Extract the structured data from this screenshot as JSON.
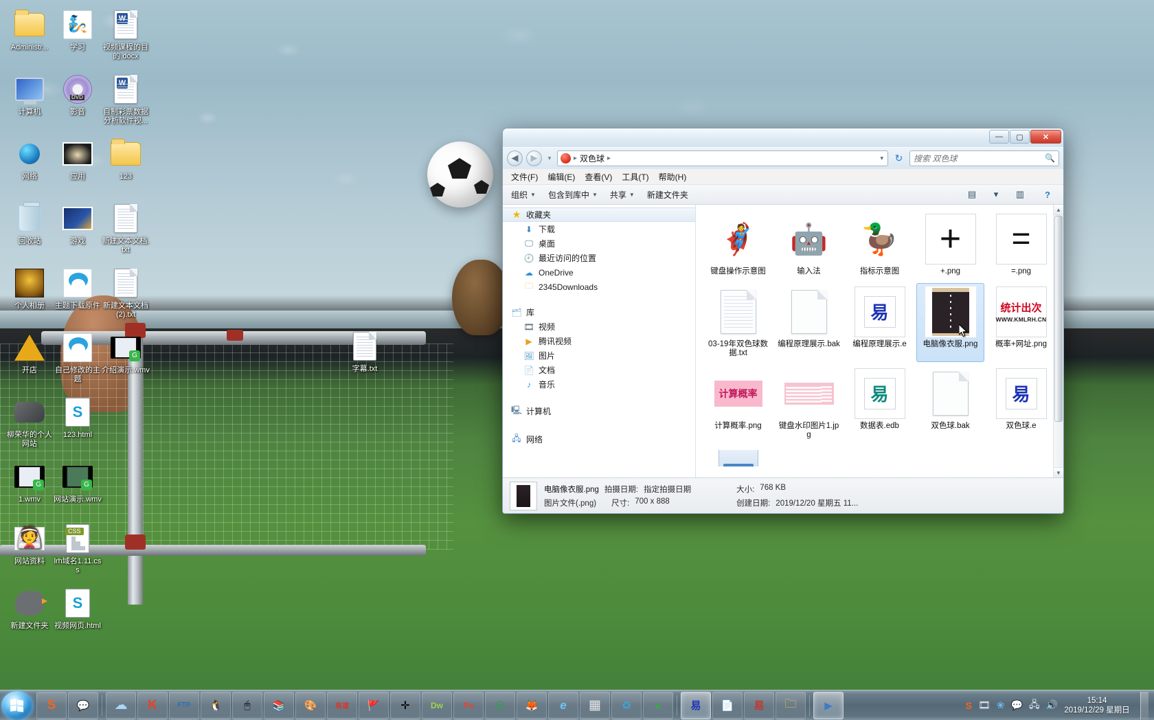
{
  "desktop": {
    "icons": [
      {
        "label": "Administr...",
        "icon": "user-folder-icon",
        "art": "folder-user"
      },
      {
        "label": "学习",
        "icon": "smurf-picture-icon",
        "art": "smurf"
      },
      {
        "label": "视频课程的目的.docx",
        "icon": "word-document-icon",
        "art": "word"
      },
      {
        "label": "计算机",
        "icon": "computer-icon",
        "art": "monitor"
      },
      {
        "label": "影音",
        "icon": "dvd-disc-icon",
        "art": "dvd"
      },
      {
        "label": "自制彩票数据分析软件视...",
        "icon": "word-document-icon",
        "art": "word"
      },
      {
        "label": "网络",
        "icon": "network-icon",
        "art": "globe"
      },
      {
        "label": "应用",
        "icon": "picture-icon",
        "art": "pic-lamp"
      },
      {
        "label": "123",
        "icon": "folder-icon",
        "art": "folder-docs"
      },
      {
        "label": "回收站",
        "icon": "recycle-bin-icon",
        "art": "trash"
      },
      {
        "label": "游戏",
        "icon": "picture-icon",
        "art": "pic-game"
      },
      {
        "label": "新建文本文档.txt",
        "icon": "text-document-icon",
        "art": "txt"
      },
      {
        "label": "个人相册",
        "icon": "picture-icon",
        "art": "mask"
      },
      {
        "label": "主题下载原件",
        "icon": "doraemon-picture-icon",
        "art": "dora"
      },
      {
        "label": "新建文本文档(2).txt",
        "icon": "text-document-icon",
        "art": "txt"
      },
      {
        "label": "开店",
        "icon": "pyramid-icon",
        "art": "pyramid"
      },
      {
        "label": "自己修改的主题",
        "icon": "doraemon-picture-icon",
        "art": "dora"
      },
      {
        "label": "介绍演示.wmv",
        "icon": "video-file-icon",
        "art": "film"
      },
      {
        "label": "柳荣华的个人网站",
        "icon": "whistle-icon",
        "art": "whistle"
      },
      {
        "label": "123.html",
        "icon": "sogou-html-icon",
        "art": "s-doc"
      },
      {
        "label": "1.wmv",
        "icon": "video-file-icon",
        "art": "film"
      },
      {
        "label": "网站演示.wmv",
        "icon": "video-file-icon",
        "art": "film"
      },
      {
        "label": "网站资料",
        "icon": "wedding-picture-icon",
        "art": "wedding"
      },
      {
        "label": "lrh域名1.11.css",
        "icon": "css-file-icon",
        "art": "css"
      },
      {
        "label": "新建文件夹",
        "icon": "bird-icon",
        "art": "bird"
      },
      {
        "label": "视频网页.html",
        "icon": "sogou-html-icon",
        "art": "s-doc"
      }
    ],
    "center_icon": {
      "label": "字幕.txt",
      "icon": "text-document-icon"
    }
  },
  "explorer": {
    "window_title": "",
    "window_buttons": {
      "minimize": "—",
      "maximize": "▢",
      "close": "✕"
    },
    "nav": {
      "back_label": "◀",
      "forward_label": "▶",
      "history_caret": "▾",
      "address_crumbs": [
        "双色球"
      ],
      "address_caret": "▾",
      "refresh_label": "↻",
      "search_placeholder": "搜索 双色球",
      "search_icon": "🔍"
    },
    "menu": [
      "文件(F)",
      "编辑(E)",
      "查看(V)",
      "工具(T)",
      "帮助(H)"
    ],
    "toolbar": {
      "organize": "组织",
      "include_in_library": "包含到库中",
      "share": "共享",
      "new_folder": "新建文件夹",
      "layout_icon": "▤",
      "layout_caret": "▾",
      "preview_icon": "▥",
      "help_icon": "?"
    },
    "navpane": {
      "groups": [
        {
          "title": "收藏夹",
          "icon": "star-icon",
          "items": [
            {
              "label": "下载",
              "icon": "download-icon"
            },
            {
              "label": "桌面",
              "icon": "desktop-icon"
            },
            {
              "label": "最近访问的位置",
              "icon": "recent-places-icon"
            },
            {
              "label": "OneDrive",
              "icon": "onedrive-cloud-icon"
            },
            {
              "label": "2345Downloads",
              "icon": "folder-icon"
            }
          ]
        },
        {
          "title": "库",
          "icon": "library-icon",
          "items": [
            {
              "label": "视频",
              "icon": "video-library-icon"
            },
            {
              "label": "腾讯视频",
              "icon": "tencent-video-icon"
            },
            {
              "label": "图片",
              "icon": "pictures-library-icon"
            },
            {
              "label": "文档",
              "icon": "documents-library-icon"
            },
            {
              "label": "音乐",
              "icon": "music-library-icon"
            }
          ]
        },
        {
          "title": "计算机",
          "icon": "computer-icon",
          "items": []
        },
        {
          "title": "网络",
          "icon": "network-icon",
          "items": []
        }
      ]
    },
    "files": [
      {
        "name": "键盘操作示意图",
        "thumb": "astro-boy-image",
        "selected": false
      },
      {
        "name": "输入法",
        "thumb": "optimus-prime-image",
        "selected": false
      },
      {
        "name": "指标示意图",
        "thumb": "donald-duck-image",
        "selected": false
      },
      {
        "name": "+.png",
        "thumb": "plus-sign-image",
        "selected": false
      },
      {
        "name": "=.png",
        "thumb": "equals-sign-image",
        "selected": false
      },
      {
        "name": "03-19年双色球数据.txt",
        "thumb": "lined-text-document",
        "selected": false
      },
      {
        "name": "编程原理展示.bak",
        "thumb": "blank-document",
        "selected": false
      },
      {
        "name": "编程原理展示.e",
        "thumb": "easy-language-blue-icon",
        "selected": false
      },
      {
        "name": "电脑像衣服.png",
        "thumb": "black-coat-photo",
        "selected": true
      },
      {
        "name": "概率+网址.png",
        "thumb": "statistics-website-image",
        "selected": false
      },
      {
        "name": "计算概率.png",
        "thumb": "pink-calc-probability-image",
        "selected": false
      },
      {
        "name": "键盘水印图片1.jpg",
        "thumb": "pink-keyboard-watermark-image",
        "selected": false
      },
      {
        "name": "数据表.edb",
        "thumb": "easy-language-teal-icon",
        "selected": false
      },
      {
        "name": "双色球.bak",
        "thumb": "blank-document",
        "selected": false
      },
      {
        "name": "双色球.e",
        "thumb": "easy-language-blue-icon",
        "selected": false
      }
    ],
    "statistics_thumb": {
      "line1": "统计出次",
      "line2": "WWW.KMLRH.CN"
    },
    "calc_thumb_text": "计算概率",
    "details": {
      "file_name": "电脑像衣服.png",
      "shoot_date_label": "拍摄日期:",
      "shoot_date_value": "指定拍摄日期",
      "file_type": "图片文件(.png)",
      "dimensions_label": "尺寸:",
      "dimensions_value": "700 x 888",
      "size_label": "大小:",
      "size_value": "768 KB",
      "created_label": "创建日期:",
      "created_value": "2019/12/20 星期五 11..."
    },
    "scrollbar": {
      "up": "▲",
      "down": "▼"
    }
  },
  "taskbar": {
    "start_label": "start-orb",
    "buttons": [
      {
        "icon": "sogou-browser-icon",
        "glyph": "S",
        "color": "#f26522",
        "active": false
      },
      {
        "icon": "wechat-icon",
        "glyph": "💬",
        "color": "#4caf50",
        "active": false
      },
      {
        "icon": "cloud-icon",
        "glyph": "☁",
        "color": "#5bb4e8",
        "active": false
      },
      {
        "icon": "kingsoft-icon",
        "glyph": "K",
        "color": "#e8431f",
        "active": false
      },
      {
        "icon": "ftp-icon",
        "glyph": "FTP",
        "color": "#2f6fb5",
        "active": false
      },
      {
        "icon": "qq-penguin-icon",
        "glyph": "🐧",
        "color": "#f5a623",
        "active": false
      },
      {
        "icon": "mouse-icon",
        "glyph": "🖱",
        "color": "#888",
        "active": false
      },
      {
        "icon": "books-icon",
        "glyph": "📚",
        "color": "#3fa34d",
        "active": false
      },
      {
        "icon": "paint-icon",
        "glyph": "🎨",
        "color": "#e54b4b",
        "active": false
      },
      {
        "icon": "youdao-icon",
        "glyph": "有道",
        "color": "#d9372b",
        "active": false
      },
      {
        "icon": "flag-icon",
        "glyph": "🚩",
        "color": "#d0021b",
        "active": false
      },
      {
        "icon": "target-icon",
        "glyph": "✛",
        "color": "#3b3b3b",
        "active": false
      },
      {
        "icon": "dreamweaver-icon",
        "glyph": "Dw",
        "color": "#1f1f1f",
        "active": false
      },
      {
        "icon": "photoshop-icon",
        "glyph": "Ps",
        "color": "#e5452c",
        "active": false
      },
      {
        "icon": "chrome-icon",
        "glyph": "◎",
        "color": "#2e9e4f",
        "active": false
      },
      {
        "icon": "firefox-icon",
        "glyph": "🦊",
        "color": "#e66000",
        "active": false
      },
      {
        "icon": "ie-icon",
        "glyph": "e",
        "color": "#1f7fc4",
        "active": false
      },
      {
        "icon": "calculator-icon",
        "glyph": "▦",
        "color": "#555",
        "active": false
      },
      {
        "icon": "recycle-icon",
        "glyph": "♻",
        "color": "#3aa6dd",
        "active": false
      },
      {
        "icon": "green-app-icon",
        "glyph": "▲",
        "color": "#3fa34d",
        "active": false
      },
      {
        "icon": "easy-language-icon",
        "glyph": "易",
        "color": "#1d34b5",
        "active": true
      },
      {
        "icon": "notepad-icon",
        "glyph": "📄",
        "color": "#9bb7cf",
        "active": false
      },
      {
        "icon": "easy-doc-icon",
        "glyph": "易",
        "color": "#c0392b",
        "active": false
      },
      {
        "icon": "explorer-folder-icon",
        "glyph": "🗀",
        "color": "#f0c04a",
        "active": false
      },
      {
        "icon": "media-player-icon",
        "glyph": "▶",
        "color": "#3b7dc4",
        "active": true
      }
    ],
    "tray": [
      {
        "icon": "sogou-tray-icon",
        "glyph": "S"
      },
      {
        "icon": "film-tray-icon",
        "glyph": "🎞"
      },
      {
        "icon": "browser-tray-icon",
        "glyph": "❀"
      },
      {
        "icon": "wechat-tray-icon",
        "glyph": "💬"
      },
      {
        "icon": "network-tray-icon",
        "glyph": "🖧"
      },
      {
        "icon": "volume-tray-icon",
        "glyph": "🔊"
      }
    ],
    "clock": {
      "time": "15:14",
      "date": "2019/12/29 星期日"
    }
  }
}
